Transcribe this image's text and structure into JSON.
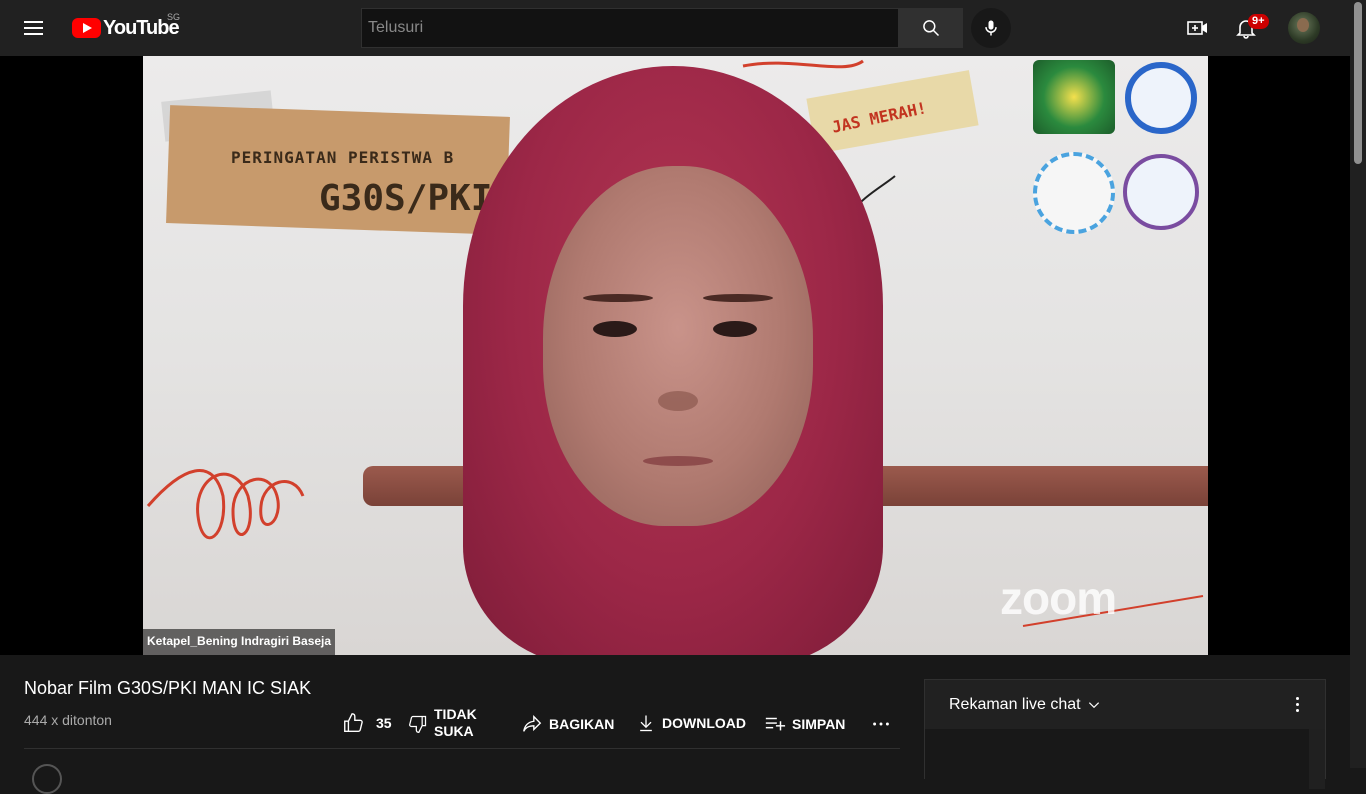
{
  "header": {
    "logo_text": "YouTube",
    "region": "SG",
    "search_placeholder": "Telusuri",
    "notification_count": "9+"
  },
  "video": {
    "banner_line1": "PERINGATAN PERISTWA B",
    "banner_line2": "G30S/PKI",
    "note_text": "JAS MERAH!",
    "watermark": "zoom",
    "participant_name": "Ketapel_Bening Indragiri Baseja"
  },
  "info": {
    "title": "Nobar Film G30S/PKI MAN IC SIAK",
    "views": "444 x ditonton",
    "like_count": "35",
    "dislike_label_1": "TIDAK",
    "dislike_label_2": "SUKA",
    "share_label": "BAGIKAN",
    "download_label": "DOWNLOAD",
    "save_label": "SIMPAN"
  },
  "chat": {
    "header_label": "Rekaman live chat"
  },
  "colors": {
    "background": "#181818",
    "header": "#212121",
    "accent_red": "#ff0000",
    "badge_red": "#cc0000",
    "text_secondary": "#aaaaaa"
  }
}
